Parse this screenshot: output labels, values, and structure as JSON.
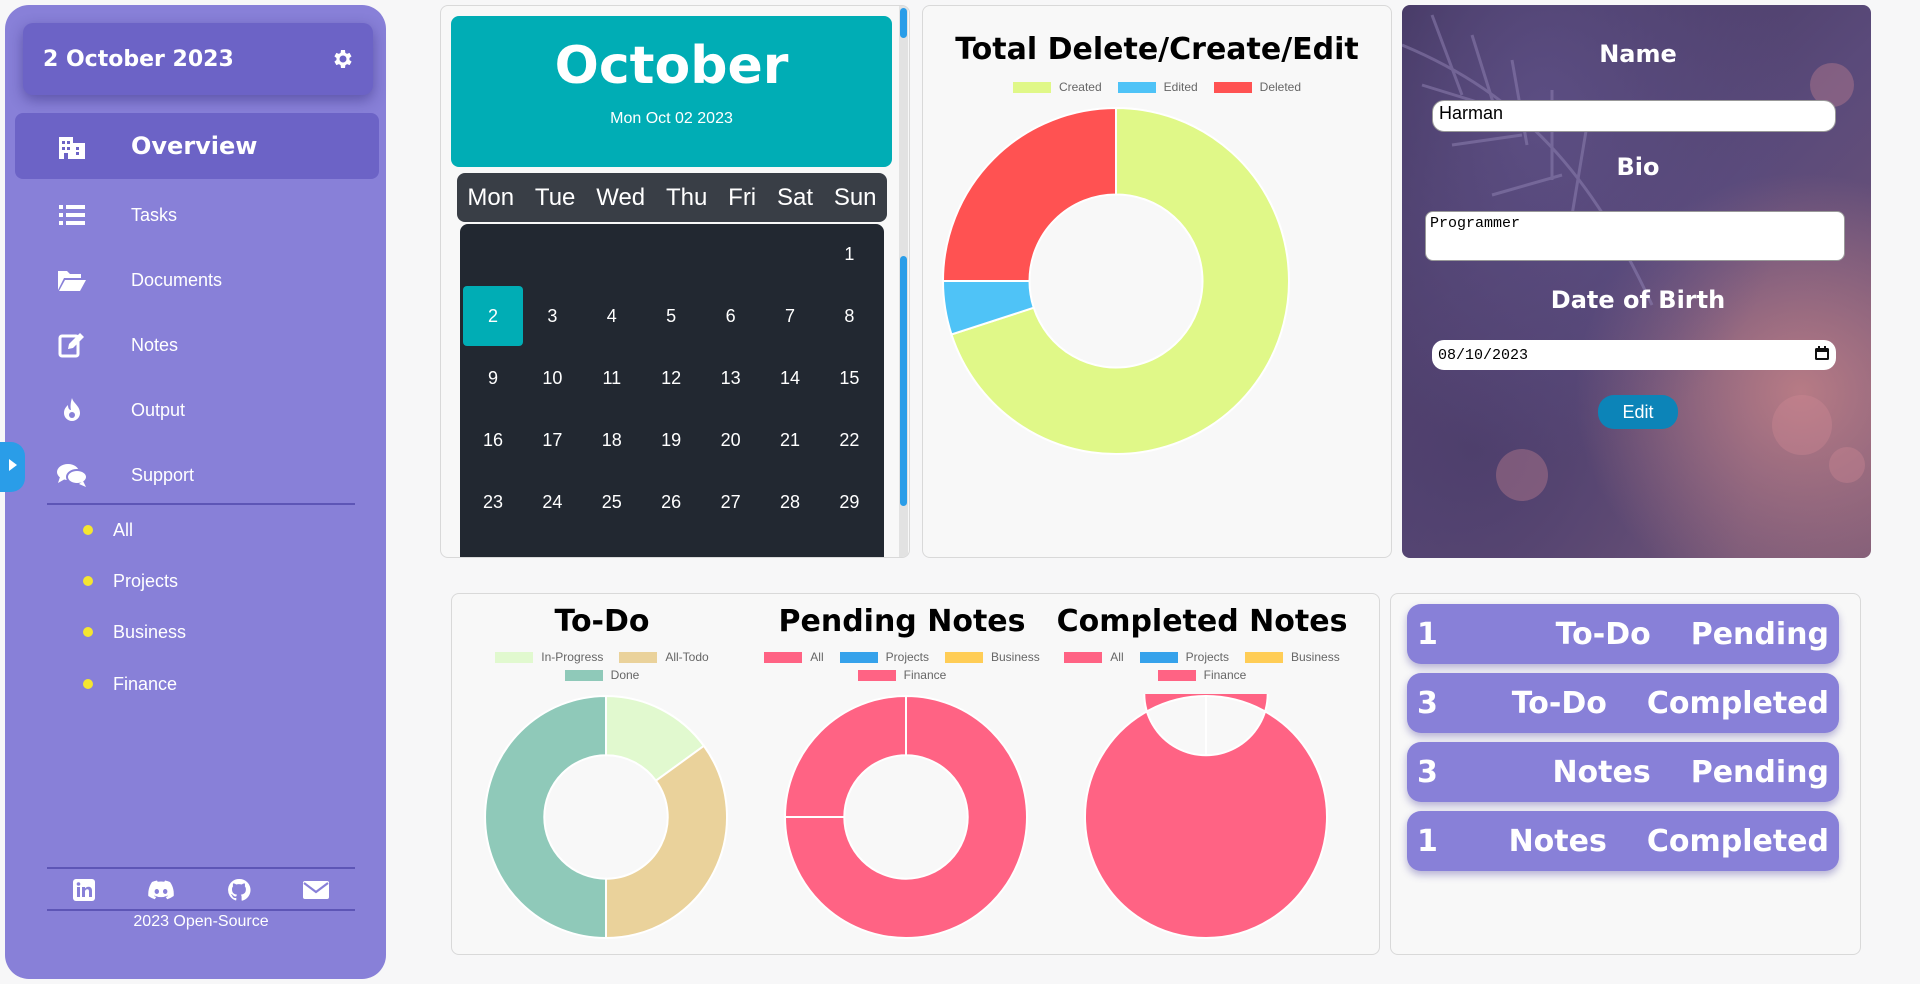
{
  "sidebar": {
    "date": "2 October 2023",
    "nav": [
      {
        "label": "Overview",
        "icon": "building-icon"
      },
      {
        "label": "Tasks",
        "icon": "list-icon"
      },
      {
        "label": "Documents",
        "icon": "folder-open-icon"
      },
      {
        "label": "Notes",
        "icon": "edit-icon"
      },
      {
        "label": "Output",
        "icon": "fire-icon"
      },
      {
        "label": "Support",
        "icon": "comments-icon"
      }
    ],
    "sub_items": [
      "All",
      "Projects",
      "Business",
      "Finance"
    ],
    "social": [
      "linkedin-icon",
      "discord-icon",
      "github-icon",
      "envelope-icon"
    ],
    "footer": "2023 Open-Source",
    "colors": {
      "bg": "#8880d8",
      "active": "#6c63c6",
      "dot": "#f5e630"
    }
  },
  "calendar": {
    "month": "October",
    "date_line": "Mon Oct 02 2023",
    "weekdays": [
      "Mon",
      "Tue",
      "Wed",
      "Thu",
      "Fri",
      "Sat",
      "Sun"
    ],
    "weeks": [
      [
        "",
        "",
        "",
        "",
        "",
        "",
        "1"
      ],
      [
        "2",
        "3",
        "4",
        "5",
        "6",
        "7",
        "8"
      ],
      [
        "9",
        "10",
        "11",
        "12",
        "13",
        "14",
        "15"
      ],
      [
        "16",
        "17",
        "18",
        "19",
        "20",
        "21",
        "22"
      ],
      [
        "23",
        "24",
        "25",
        "26",
        "27",
        "28",
        "29"
      ]
    ],
    "today": "2",
    "colors": {
      "header": "#00adb5",
      "grid": "#222831",
      "days": "#393e46"
    }
  },
  "totals_chart": {
    "title": "Total Delete/Create/Edit",
    "legend": [
      {
        "label": "Created",
        "color": "#e0f888"
      },
      {
        "label": "Edited",
        "color": "#4fc3f7"
      },
      {
        "label": "Deleted",
        "color": "#ff5252"
      }
    ]
  },
  "profile": {
    "name_label": "Name",
    "name_value": "Harman",
    "bio_label": "Bio",
    "bio_value": "Programmer",
    "dob_label": "Date of Birth",
    "dob_value": "08/10/2023",
    "edit_label": "Edit"
  },
  "todo_chart": {
    "title": "To-Do",
    "legend": [
      {
        "label": "In-Progress",
        "color": "#e1f9cf"
      },
      {
        "label": "All-Todo",
        "color": "#ead29b"
      },
      {
        "label": "Done",
        "color": "#8fc9b9"
      }
    ]
  },
  "pending_chart": {
    "title": "Pending Notes",
    "legend": [
      {
        "label": "All",
        "color": "#ff6384"
      },
      {
        "label": "Projects",
        "color": "#36a2eb"
      },
      {
        "label": "Business",
        "color": "#ffcd56"
      },
      {
        "label": "Finance",
        "color": "#ff6384"
      }
    ]
  },
  "completed_chart": {
    "title": "Completed Notes",
    "legend": [
      {
        "label": "All",
        "color": "#ff6384"
      },
      {
        "label": "Projects",
        "color": "#36a2eb"
      },
      {
        "label": "Business",
        "color": "#ffcd56"
      },
      {
        "label": "Finance",
        "color": "#ff6384"
      }
    ]
  },
  "stats": [
    {
      "count": "1",
      "type": "To-Do",
      "status": "Pending"
    },
    {
      "count": "3",
      "type": "To-Do",
      "status": "Completed"
    },
    {
      "count": "3",
      "type": "Notes",
      "status": "Pending"
    },
    {
      "count": "1",
      "type": "Notes",
      "status": "Completed"
    }
  ],
  "chart_data": [
    {
      "type": "pie",
      "title": "Total Delete/Create/Edit",
      "categories": [
        "Created",
        "Edited",
        "Deleted"
      ],
      "values": [
        70,
        5,
        25
      ],
      "colors": [
        "#e0f888",
        "#4fc3f7",
        "#ff5252"
      ],
      "legend": "top"
    },
    {
      "type": "pie",
      "title": "To-Do",
      "categories": [
        "In-Progress",
        "All-Todo",
        "Done"
      ],
      "values": [
        15,
        35,
        50
      ],
      "colors": [
        "#e1f9cf",
        "#ead29b",
        "#8fc9b9"
      ],
      "legend": "top"
    },
    {
      "type": "pie",
      "title": "Pending Notes",
      "categories": [
        "All",
        "Projects",
        "Business",
        "Finance"
      ],
      "values": [
        3,
        0,
        0,
        1
      ],
      "colors": [
        "#ff6384",
        "#36a2eb",
        "#ffcd56",
        "#ff6384"
      ],
      "legend": "top"
    },
    {
      "type": "pie",
      "title": "Completed Notes",
      "categories": [
        "All",
        "Projects",
        "Business",
        "Finance"
      ],
      "values": [
        1,
        0,
        0,
        0
      ],
      "colors": [
        "#ff6384",
        "#36a2eb",
        "#ffcd56",
        "#ff6384"
      ],
      "legend": "top"
    }
  ]
}
